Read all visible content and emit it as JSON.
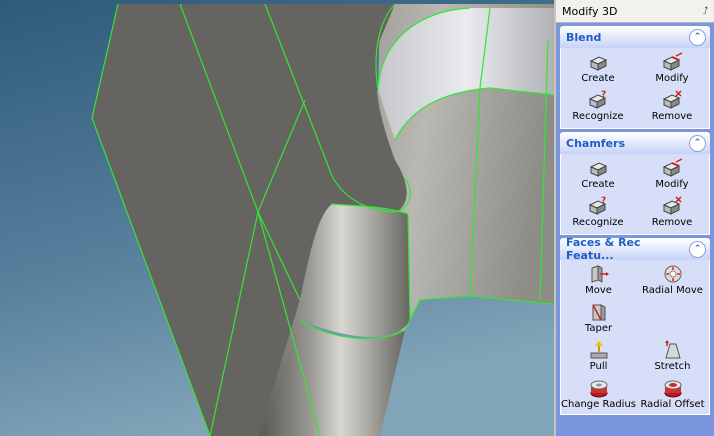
{
  "panel": {
    "title": "Modify 3D",
    "pin_icon": "pin-icon",
    "groups": [
      {
        "title": "Blend",
        "items": [
          {
            "label": "Create",
            "icon": "blend-create-icon"
          },
          {
            "label": "Modify",
            "icon": "blend-modify-icon"
          },
          {
            "label": "Recognize",
            "icon": "blend-recognize-icon"
          },
          {
            "label": "Remove",
            "icon": "blend-remove-icon"
          }
        ]
      },
      {
        "title": "Chamfers",
        "items": [
          {
            "label": "Create",
            "icon": "chamfer-create-icon"
          },
          {
            "label": "Modify",
            "icon": "chamfer-modify-icon"
          },
          {
            "label": "Recognize",
            "icon": "chamfer-recognize-icon"
          },
          {
            "label": "Remove",
            "icon": "chamfer-remove-icon"
          }
        ]
      },
      {
        "title": "Faces & Rec Featu...",
        "items": [
          {
            "label": "Move",
            "icon": "move-face-icon"
          },
          {
            "label": "Radial Move",
            "icon": "radial-move-icon"
          },
          {
            "label": "Taper",
            "icon": "taper-icon"
          },
          {
            "label": "",
            "icon": ""
          },
          {
            "label": "Pull",
            "icon": "pull-icon"
          },
          {
            "label": "Stretch",
            "icon": "stretch-icon"
          },
          {
            "label": "Change Radius",
            "icon": "change-radius-icon"
          },
          {
            "label": "Radial Offset",
            "icon": "radial-offset-icon"
          }
        ]
      }
    ]
  },
  "colors": {
    "edge_highlight": "#33e633",
    "panel_bg": "#7a96df",
    "group_header_text": "#215dc6"
  }
}
